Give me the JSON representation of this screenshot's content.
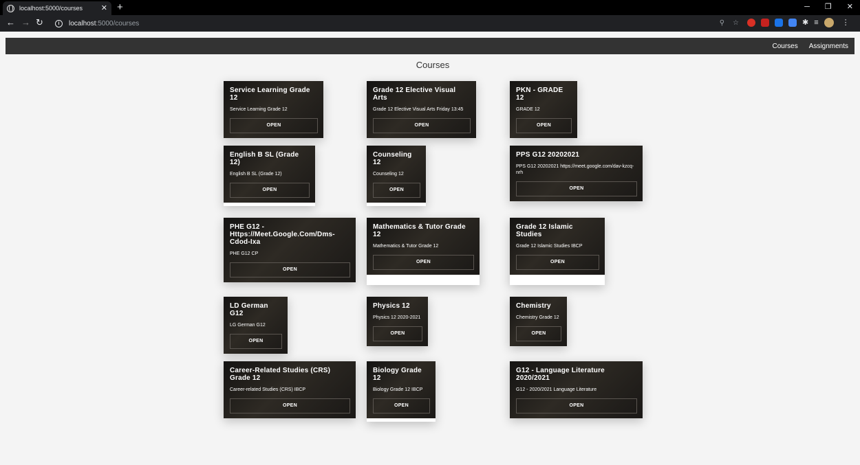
{
  "browser": {
    "tab_title": "localhost:5000/courses",
    "tab_close": "✕",
    "new_tab": "+",
    "url_host": "localhost",
    "url_path": ":5000/courses",
    "icons": [
      "globe-icon",
      "back-icon",
      "forward-icon",
      "reload-icon",
      "info-icon",
      "zoom-icon",
      "star-icon",
      "extensions-icon",
      "reading-list-icon",
      "profile-avatar",
      "menu-icon"
    ]
  },
  "nav": {
    "courses": "Courses",
    "assignments": "Assignments"
  },
  "page": {
    "title": "Courses"
  },
  "open_label": "OPEN",
  "courses": [
    {
      "title": "Service Learning Grade 12",
      "desc": "Service Learning Grade 12"
    },
    {
      "title": "Grade 12 Elective Visual Arts",
      "desc": "Grade 12 Elective Visual Arts Friday 13:45"
    },
    {
      "title": "PKN - GRADE 12",
      "desc": "GRADE 12"
    },
    {
      "title": "English B SL (Grade 12)",
      "desc": "English B SL (Grade 12)"
    },
    {
      "title": "Counseling 12",
      "desc": "Counseling 12"
    },
    {
      "title": "PPS G12 20202021",
      "desc": "PPS G12 20202021 https://meet.google.com/dav-kzcq-nrh"
    },
    {
      "title": "PHE G12 -\nHttps://Meet.Google.Com/Dms-\nCdod-Ixa",
      "desc": "PHE G12 CP"
    },
    {
      "title": "Mathematics & Tutor Grade 12",
      "desc": "Mathematics & Tutor Grade 12"
    },
    {
      "title": "Grade 12 Islamic Studies",
      "desc": "Grade 12 Islamic Studies IBCP"
    },
    {
      "title": "LD German G12",
      "desc": "LG German G12"
    },
    {
      "title": "Physics 12",
      "desc": "Physics 12 2020-2021"
    },
    {
      "title": "Chemistry",
      "desc": "Chemistry Grade 12"
    },
    {
      "title": "Career-Related Studies (CRS)\nGrade 12",
      "desc": "Career-related Studies (CRS) IBCP"
    },
    {
      "title": "Biology Grade 12",
      "desc": "Biology Grade 12 IBCP"
    },
    {
      "title": "G12 - Language Literature\n2020/2021",
      "desc": "G12 - 2020/2021 Language Literature"
    }
  ]
}
